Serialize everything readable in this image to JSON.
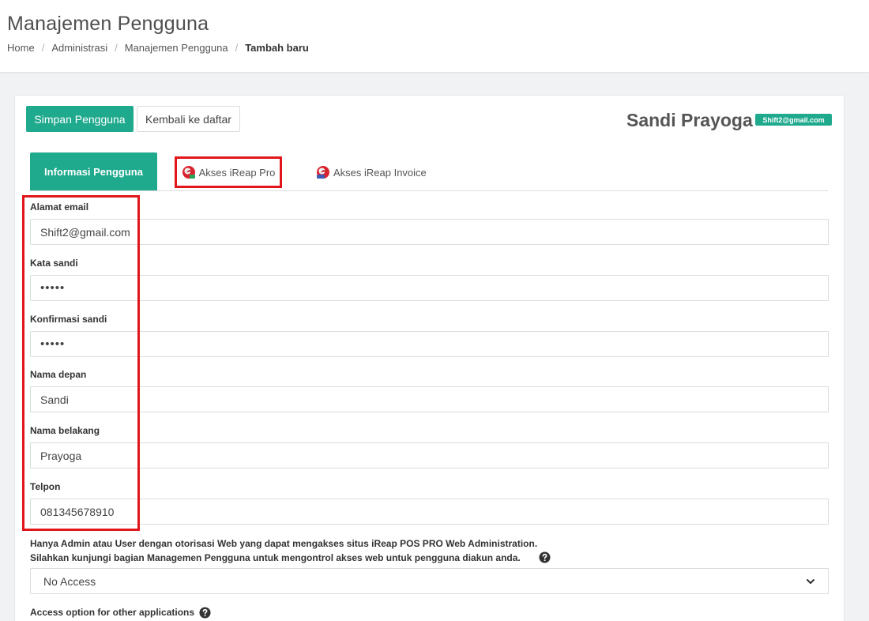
{
  "header": {
    "title": "Manajemen Pengguna",
    "breadcrumb": [
      "Home",
      "Administrasi",
      "Manajemen Pengguna",
      "Tambah baru"
    ]
  },
  "toolbar": {
    "save_label": "Simpan Pengguna",
    "back_label": "Kembali ke daftar"
  },
  "user": {
    "name": "Sandi Prayoga",
    "email_badge": "Shift2@gmail.com"
  },
  "tabs": [
    {
      "label": "Informasi Pengguna",
      "active": true
    },
    {
      "label": "Akses iReap Pro",
      "icon": "ireap-pro-icon"
    },
    {
      "label": "Akses iReap Invoice",
      "icon": "ireap-invoice-icon"
    }
  ],
  "form": {
    "email": {
      "label": "Alamat email",
      "value": "Shift2@gmail.com"
    },
    "password": {
      "label": "Kata sandi",
      "value": "•••••"
    },
    "confirm_password": {
      "label": "Konfirmasi sandi",
      "value": "•••••"
    },
    "first_name": {
      "label": "Nama depan",
      "value": "Sandi"
    },
    "last_name": {
      "label": "Nama belakang",
      "value": "Prayoga"
    },
    "phone": {
      "label": "Telpon",
      "value": "081345678910"
    }
  },
  "web_access": {
    "note_line1": "Hanya Admin atau User dengan otorisasi Web yang dapat mengakses situs iReap POS PRO Web Administration.",
    "note_line2": "Silahkan kunjungi bagian Managemen Pengguna untuk mengontrol akses web untuk pengguna diakun anda.",
    "selected": "No Access"
  },
  "other_apps": {
    "label": "Access option for other applications"
  },
  "colors": {
    "accent": "#1fa98d",
    "highlight": "#e0161b"
  }
}
